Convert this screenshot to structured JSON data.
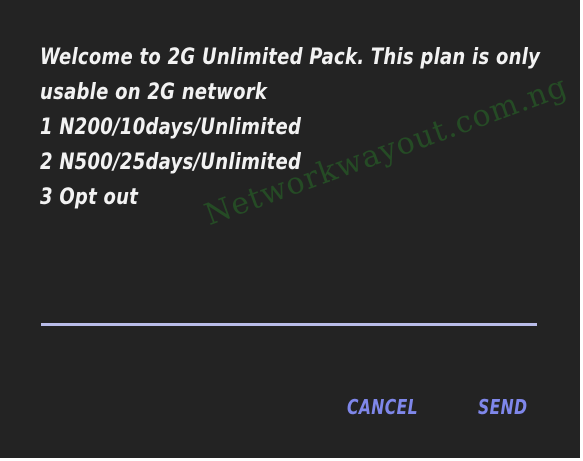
{
  "dialog": {
    "lines": [
      "Welcome to 2G Unlimited Pack. This plan is only",
      "usable on 2G network",
      "1 N200/10days/Unlimited",
      "2 N500/25days/Unlimited",
      "3 Opt out"
    ],
    "watermark": "Networkwayout.com.ng",
    "input_value": "",
    "cancel_label": "CANCEL",
    "send_label": "SEND"
  },
  "colors": {
    "background": "#232323",
    "text": "#f2f2f2",
    "softkey": "#7f87ea",
    "input_underline": "#b9bce8"
  }
}
